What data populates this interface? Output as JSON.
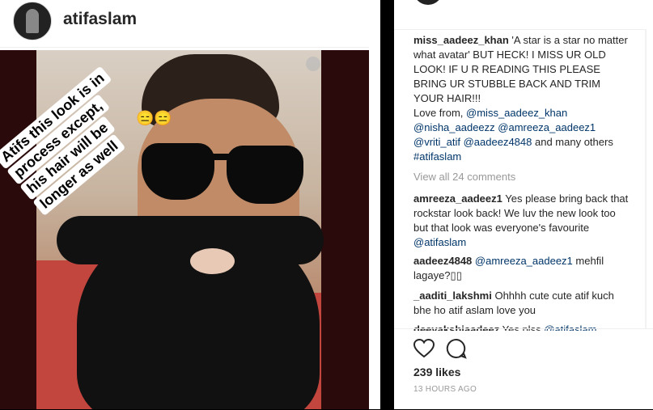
{
  "post": {
    "username": "atifaslam",
    "sticker_lines": [
      "Atifs this look is in",
      "process except,",
      "his hair will be",
      "longer as well"
    ],
    "emoji": "😑😑"
  },
  "comments": [
    {
      "user": "miss_aadeez_khan",
      "text": "'A star is a star no matter what avatar' BUT HECK! I MISS UR OLD LOOK! IF U R READING THIS PLEASE BRING UR STUBBLE BACK AND TRIM YOUR HAIR!!!",
      "extra": "Love from, ",
      "mentions": "@miss_aadeez_khan @nisha_aadeezz @amreeza_aadeez1 @vriti_atif @aadeez4848",
      "tail": " and many others ",
      "tag": "#atifaslam"
    },
    {
      "user": "amreeza_aadeez1",
      "text": "Yes please bring back that rockstar look back! We luv the new look too but that look was everyone's favourite ",
      "mention": "@atifaslam"
    },
    {
      "user": "aadeez4848",
      "mention": "@amreeza_aadeez1",
      "text": " mehfil lagaye?▯▯"
    },
    {
      "user": "_aaditi_lakshmi",
      "text": "Ohhhh cute cute atif kuch bhe ho atif aslam love you"
    },
    {
      "user": "deevakshiaadeez",
      "text": "Yes plss ",
      "mention": "@atifaslam"
    }
  ],
  "view_all": "View all 24 comments",
  "likes": "239 likes",
  "timestamp": "13 HOURS AGO"
}
